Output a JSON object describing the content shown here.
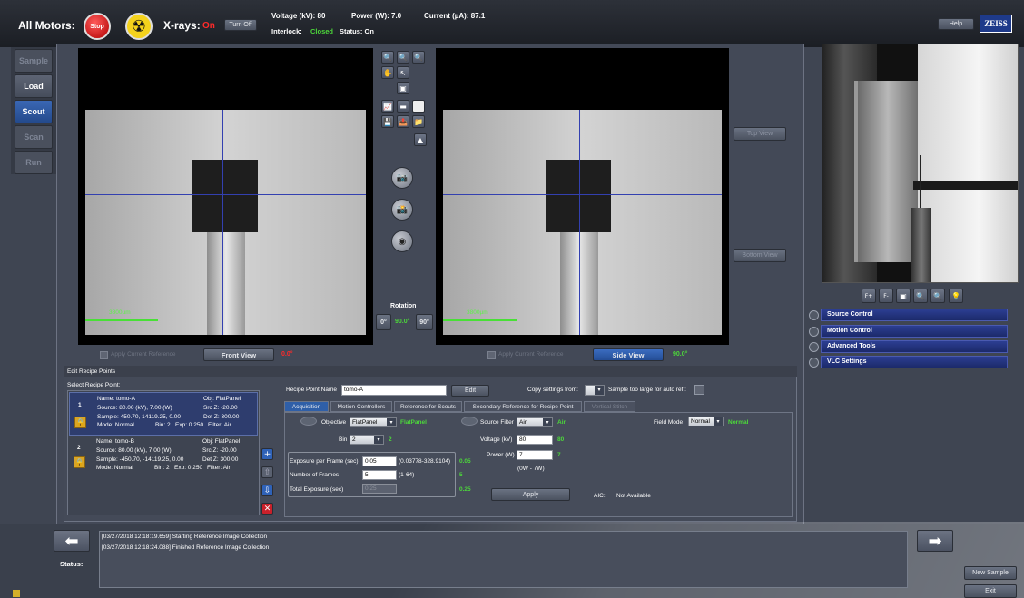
{
  "header": {
    "all_motors_label": "All Motors:",
    "stop_label": "Stop",
    "xrays_label": "X-rays:",
    "xrays_state": "On",
    "turn_off_label": "Turn Off",
    "voltage_label": "Voltage (kV): 80",
    "power_label": "Power (W): 7.0",
    "current_label": "Current (µA): 87.1",
    "interlock_label": "Interlock:",
    "interlock_value": "Closed",
    "status_label": "Status: On",
    "help_label": "Help",
    "brand": "ZEISS"
  },
  "nav": {
    "sample": "Sample",
    "load": "Load",
    "scout": "Scout",
    "scan": "Scan",
    "run": "Run"
  },
  "viewers": {
    "left_scale": "3800µm",
    "right_scale": "3800µm",
    "apply_left": "Apply Current Reference",
    "front_view": "Front View",
    "front_angle": "0.0°",
    "apply_right": "Apply Current Reference",
    "side_view": "Side View",
    "side_angle": "90.0°",
    "top_view": "Top View",
    "bottom_view": "Bottom View"
  },
  "rotation": {
    "label": "Rotation",
    "btn_0": "0°",
    "value": "90.0°",
    "btn_90": "90°"
  },
  "camera_buttons": [
    "F+",
    "F-"
  ],
  "panels": [
    "Source Control",
    "Motion Control",
    "Advanced Tools",
    "VLC Settings"
  ],
  "recipe": {
    "section_title": "Edit Recipe Points",
    "select_label": "Select Recipe Point:",
    "points": [
      {
        "index": "1",
        "name": "Name: tomo-A",
        "obj": "Obj: FlatPanel",
        "source": "Source: 80.00 (kV), 7.00 (W)",
        "src_z": "Src Z: -20.00",
        "sample": "Sample: 450.70, 14119.25, 0.00",
        "det_z": "Det Z: 300.00",
        "mode": "Mode: Normal",
        "bin": "Bin: 2",
        "exp": "Exp: 0.250",
        "filter": "Filter: Air"
      },
      {
        "index": "2",
        "name": "Name: tomo-B",
        "obj": "Obj: FlatPanel",
        "source": "Source: 80.00 (kV), 7.00 (W)",
        "src_z": "Src Z: -20.00",
        "sample": "Sample: -450.70, -14119.25, 0.00",
        "det_z": "Det Z: 300.00",
        "mode": "Mode: Normal",
        "bin": "Bin: 2",
        "exp": "Exp: 0.250",
        "filter": "Filter: Air"
      }
    ],
    "point_name_label": "Recipe Point Name",
    "point_name_value": "tomo-A",
    "edit_label": "Edit",
    "copy_label": "Copy settings from:",
    "too_large_label": "Sample too large for auto ref.:",
    "tabs": [
      "Acquisition",
      "Motion Controllers",
      "Reference for Scouts",
      "Secondary Reference for Recipe Point",
      "Vertical Stitch"
    ],
    "objective_label": "Objective",
    "objective_value": "FlatPanel",
    "objective_status": "FlatPanel",
    "bin_label": "Bin",
    "bin_value": "2",
    "bin_status": "2",
    "source_filter_label": "Source Filter",
    "source_filter_value": "Air",
    "source_filter_status": "Air",
    "field_mode_label": "Field Mode",
    "field_mode_value": "Normal",
    "field_mode_status": "Normal",
    "voltage_label": "Voltage (kV)",
    "voltage_value": "80",
    "voltage_status": "80",
    "power_label": "Power (W)",
    "power_value": "7",
    "power_status": "7",
    "power_range": "(0W - 7W)",
    "exposure_label": "Exposure per Frame (sec)",
    "exposure_value": "0.05",
    "exposure_range": "(0.03778-328.9104)",
    "exposure_status": "0.05",
    "frames_label": "Number of Frames",
    "frames_value": "5",
    "frames_range": "(1-64)",
    "frames_status": "5",
    "total_label": "Total Exposure (sec)",
    "total_value": "0.25",
    "total_status": "0.25",
    "apply_label": "Apply",
    "aic_label": "AIC:",
    "aic_value": "Not Available"
  },
  "log": {
    "line1": "[03/27/2018 12:18:19.659] Starting Reference Image Collection",
    "line2": "[03/27/2018 12:18:24.088] Finished Reference Image Collection",
    "status_label": "Status:"
  },
  "footer": {
    "new_sample": "New Sample",
    "exit": "Exit"
  }
}
